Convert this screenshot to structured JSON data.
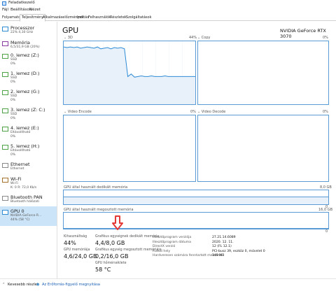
{
  "window": {
    "title": "Feladatkezelő"
  },
  "menu": [
    "Fájl",
    "Beállítások",
    "Nézet"
  ],
  "tabs": [
    "Folyamatok",
    "Teljesítmény",
    "Alkalmazáselőzmények",
    "Indítás",
    "Felhasználók",
    "Részletek",
    "Szolgáltatások"
  ],
  "sidebar": [
    {
      "name": "Processzor",
      "s1": "22% 4,30 GHz",
      "s2": ""
    },
    {
      "name": "Memória",
      "s1": "6,5/31,9 GB (20%)",
      "s2": ""
    },
    {
      "name": "0. lemez (Z:)",
      "s1": "SSD",
      "s2": "0%"
    },
    {
      "name": "1. lemez (D:)",
      "s1": "SSD",
      "s2": "0%"
    },
    {
      "name": "2. lemez (G:)",
      "s1": "SSD",
      "s2": "0%"
    },
    {
      "name": "3. lemez (Z: C:)",
      "s1": "SSD",
      "s2": "0%"
    },
    {
      "name": "4. lemez (E:)",
      "s1": "Eltávolítható",
      "s2": "0%"
    },
    {
      "name": "5. lemez (H:)",
      "s1": "Eltávolítható",
      "s2": "0%"
    },
    {
      "name": "Ethernet",
      "s1": "Ethernet",
      "s2": ""
    },
    {
      "name": "Wi-Fi",
      "s1": "Wi-Fi",
      "s2": "K: 0 R: 72,0 Kb/s"
    },
    {
      "name": "Bluetooth PAN",
      "s1": "Bluetooth hálózati",
      "s2": ""
    },
    {
      "name": "GPU 0",
      "s1": "NVIDIA GeForce R...",
      "s2": "44% (58 °C)"
    }
  ],
  "main": {
    "title": "GPU",
    "model": "NVIDIA GeForce RTX 3070",
    "graphs": {
      "g3d": {
        "label": "3D",
        "pct": "44%"
      },
      "copy": {
        "label": "Copy",
        "pct": "0%"
      },
      "venc": {
        "label": "Video Encode",
        "pct": "0%"
      },
      "vdec": {
        "label": "Video Decode",
        "pct": "0%"
      }
    },
    "dedicated_label": "GPU által használt dedikált memória",
    "dedicated_max": "8,0 GB",
    "dedicated_min": "0",
    "shared_label": "GPU által használt megosztott memória",
    "shared_max": "16,0 GB",
    "shared_min": "0",
    "stats": {
      "util_label": "Kihasználtság",
      "util_val": "44%",
      "ded_label": "Grafikus egységnek dedikált memória",
      "ded_val": "4,4/8,0 GB",
      "gmem_label": "GPU memóriája",
      "gmem_val": "4,6/24,0 GB",
      "sh_label": "Grafikus egység megosztott memóriája",
      "sh_val": "0,2/16,0 GB",
      "temp_label": "GPU hőmérséklete",
      "temp_val": "58 °C"
    },
    "details": [
      {
        "k": "Illesztőprogram verziója",
        "v": "27.21.14.6089"
      },
      {
        "k": "Illesztőprogram dátuma",
        "v": "2020. 12. 11."
      },
      {
        "k": "DirectX verzió",
        "v": "12 (FL 12.1)"
      },
      {
        "k": "Fizikai hely",
        "v": "PCI-busz 39, eszköz 0, művelet 0"
      },
      {
        "k": "Hardveresen számára fenntartott memória",
        "v": "149 MB"
      }
    ]
  },
  "footer": {
    "fewer": "Kevesebb részlet",
    "monitor": "Az Erőforrás-figyelő megnyitása"
  },
  "colors": {
    "accent": "#2e8bd5",
    "graph_border": "#5a9bd5",
    "graph_fill": "#e8f1fa",
    "arrow": "#e53935"
  },
  "chart_data": {
    "type": "line",
    "title": "3D",
    "ylim": [
      0,
      100
    ],
    "series": [
      {
        "values": [
          91,
          90,
          91,
          90,
          91,
          89,
          90,
          91,
          90,
          89,
          91,
          88,
          89,
          90,
          88,
          90,
          89,
          90,
          88,
          44,
          48,
          43,
          44,
          45,
          44,
          44,
          45,
          44,
          44,
          44,
          45,
          44,
          44,
          44,
          44,
          44,
          44,
          44,
          44,
          44
        ]
      }
    ]
  }
}
